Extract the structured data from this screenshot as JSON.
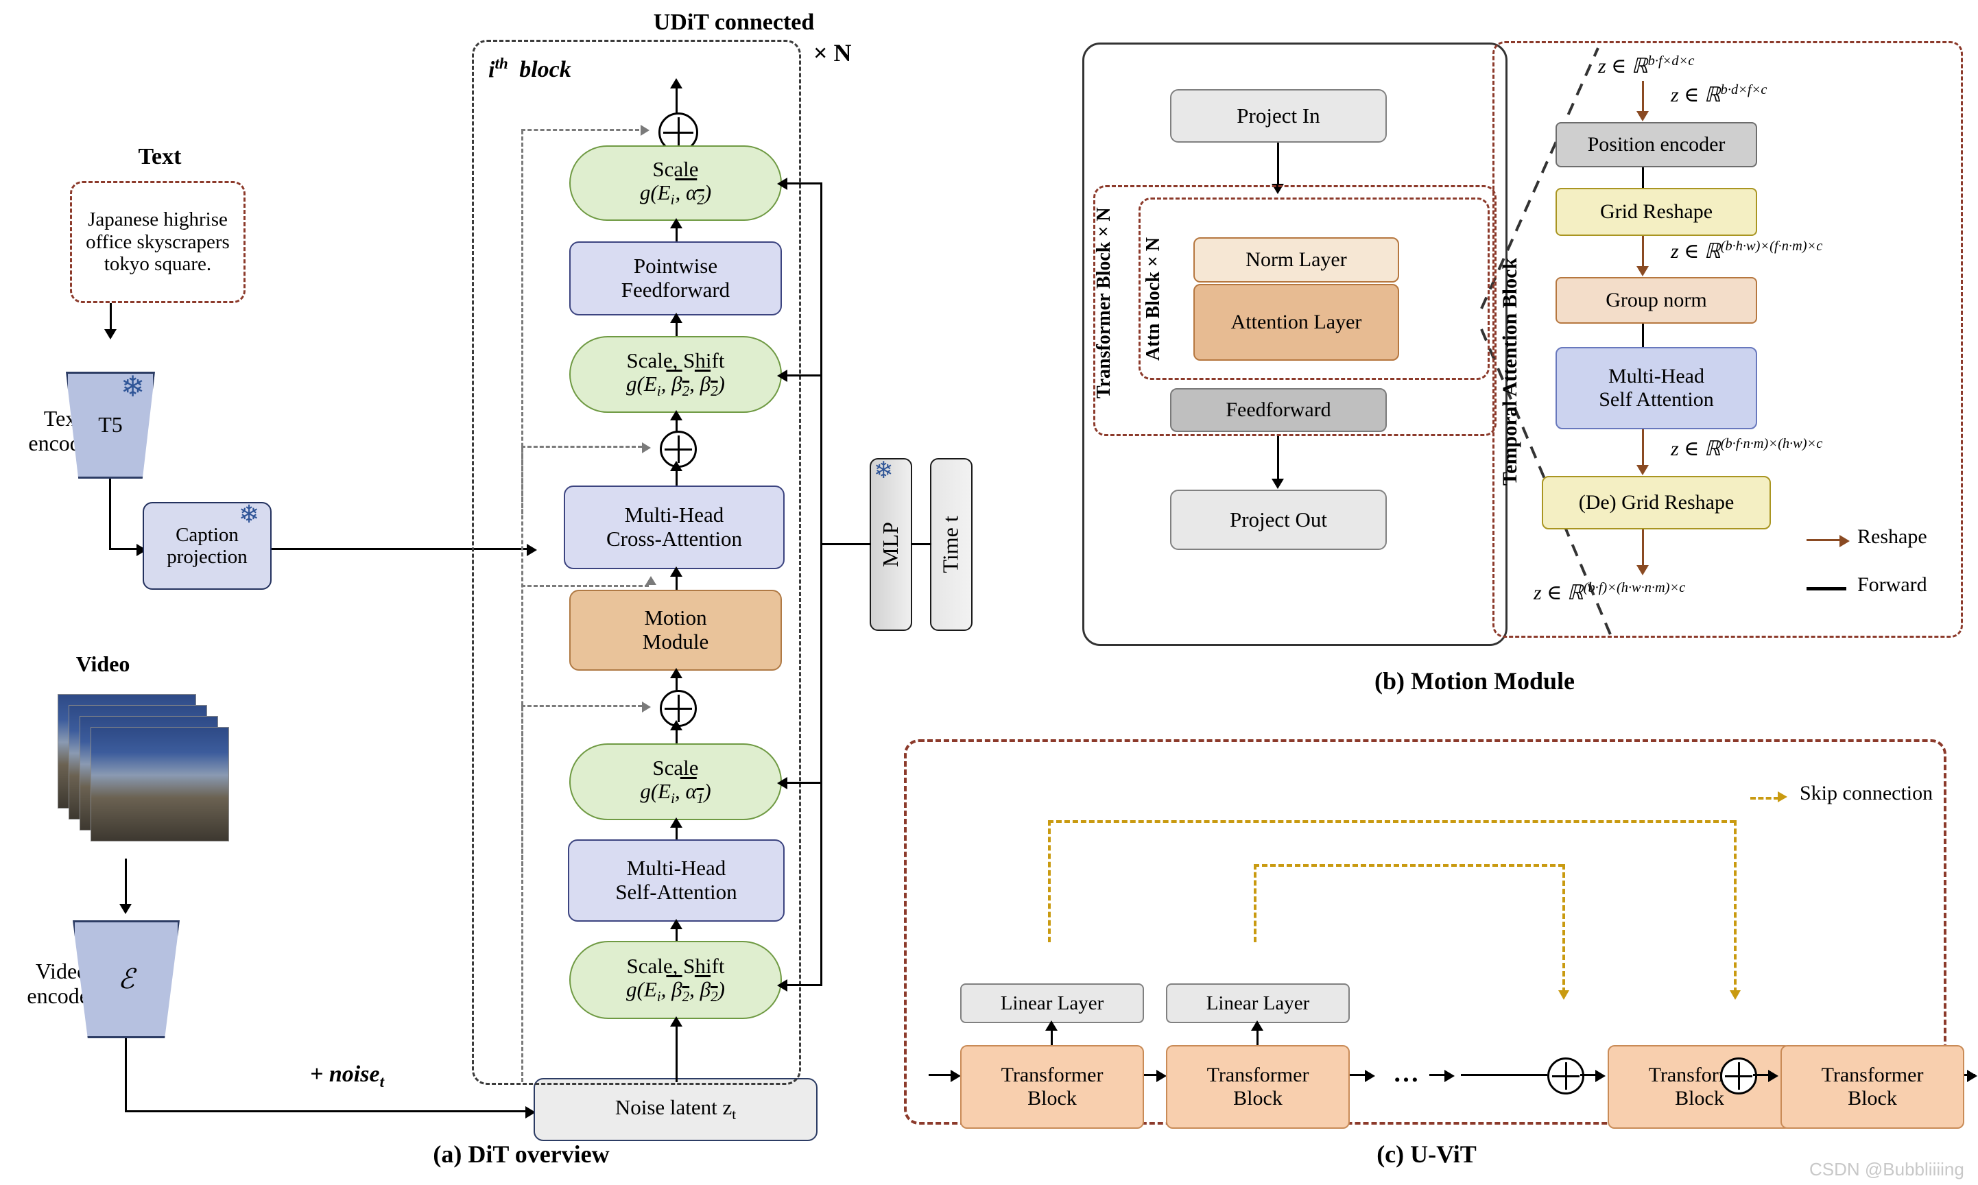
{
  "figure": {
    "panel_a_caption": "(a) DiT overview",
    "panel_b_caption": "(b) Motion Module",
    "panel_c_caption": "(c) U-ViT",
    "watermark": "CSDN @Bubbliiiing"
  },
  "panel_a": {
    "text_label": "Text",
    "prompt": "Japanese highrise office skyscrapers tokyo square.",
    "text_encoder_label": "Text encoder",
    "t5_label": "T5",
    "caption_projection_label": "Caption projection",
    "video_label": "Video",
    "video_encoder_label": "Video encoder",
    "video_encoder_symbol": "ℰ",
    "noise_add_label": "+ noise",
    "noise_add_sub": "t",
    "noise_latent_label": "Noise latent z",
    "noise_latent_sub": "t",
    "udit_title": "UDiT connected",
    "repeat_label": "× N",
    "ith_block_label": "i",
    "ith_block_sup": "th",
    "ith_block_rest": "block",
    "mlp_label": "MLP",
    "time_label": "Time t",
    "blocks": {
      "scale_a2_line1": "Scale",
      "scale_a2_line2": "g(E",
      "scale_a2_sub": "i",
      "scale_a2_tail": ", α",
      "scale_a2_alpha_sub": "2",
      "pointwise_line1": "Pointwise",
      "pointwise_line2": "Feedforward",
      "scaleshift_top_line1": "Scale, Shift",
      "cross_attn_line1": "Multi-Head",
      "cross_attn_line2": "Cross-Attention",
      "motion_line1": "Motion",
      "motion_line2": "Module",
      "scale_a1_line1": "Scale",
      "self_attn_line1": "Multi-Head",
      "self_attn_line2": "Self-Attention",
      "scaleshift_bot_line1": "Scale, Shift"
    }
  },
  "panel_b": {
    "project_in": "Project In",
    "project_out": "Project  Out",
    "transformer_block_n": "Transformer Block × N",
    "attn_block_n": "Attn Block × N",
    "norm_layer": "Norm Layer",
    "attention_layer": "Attention Layer",
    "feedforward": "Feedforward",
    "temporal_title": "Temporal Attention Block",
    "position_encoder": "Position encoder",
    "grid_reshape": "Grid Reshape",
    "group_norm": "Group norm",
    "mhsa_line1": "Multi-Head",
    "mhsa_line2": "Self Attention",
    "de_grid_reshape": "(De) Grid Reshape",
    "shape_in_1": "z ∈ ℝ",
    "shape_in_1_exp": "b·f×d×c",
    "shape_in_2_exp": "b·d×f×c",
    "shape_3_exp": "(b·h·w)×(f·n·m)×c",
    "shape_4_exp": "(b·f·n·m)×(h·w)×c",
    "shape_5_exp": "(b·f)×(h·w·n·m)×c",
    "legend_reshape": "Reshape",
    "legend_forward": "Forward"
  },
  "panel_c": {
    "linear_layer": "Linear Layer",
    "transformer_block_line1": "Transformer",
    "transformer_block_line2": "Block",
    "ellipsis": "…",
    "legend_skip": "Skip connection"
  },
  "colors": {
    "green": "#dfeecf",
    "blue": "#d9dcf2",
    "tan": "#e9c39a",
    "peach": "#f8cfae",
    "yellow": "#f4efc3",
    "red_dash": "#8c3a2b",
    "gold": "#c99a10",
    "brown_arrow": "#8a4a22",
    "snow": "#2f5597"
  }
}
